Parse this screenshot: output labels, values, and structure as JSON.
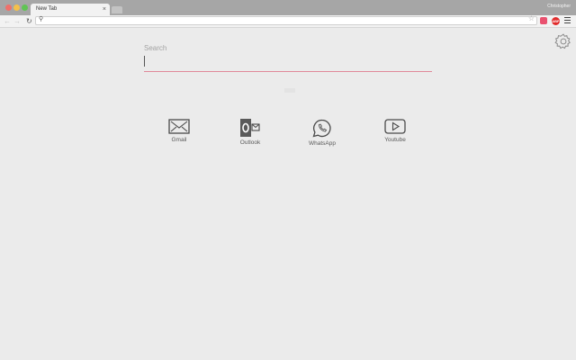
{
  "browser": {
    "tab_title": "New Tab",
    "tab_close": "×",
    "profile_name": "Christopher",
    "ext_badge": "ABP"
  },
  "search": {
    "label": "Search",
    "value": "",
    "accent_color": "#e0899a"
  },
  "shortcuts": [
    {
      "label": "Gmail",
      "icon": "mail-icon"
    },
    {
      "label": "Outlook",
      "icon": "outlook-icon"
    },
    {
      "label": "WhatsApp",
      "icon": "whatsapp-icon"
    },
    {
      "label": "Youtube",
      "icon": "youtube-icon"
    }
  ]
}
